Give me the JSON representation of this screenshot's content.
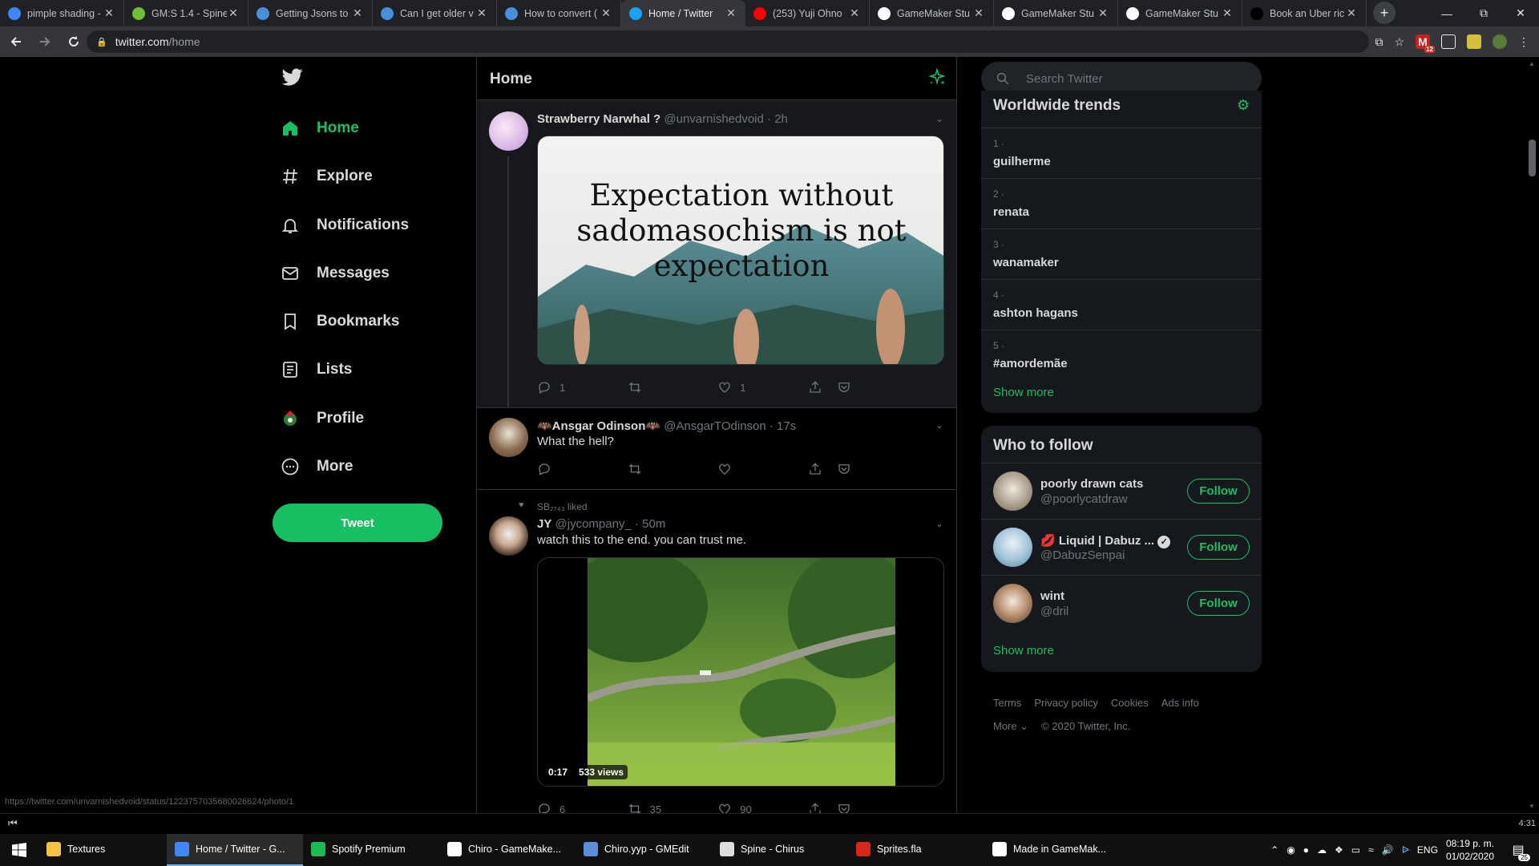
{
  "browser": {
    "tabs": [
      {
        "title": "pimple shading -",
        "icon": "google-icon",
        "color": "#4285f4",
        "active": false
      },
      {
        "title": "GM:S 1.4 - Spine",
        "icon": "gm-icon",
        "color": "#6fbf3a",
        "active": false
      },
      {
        "title": "Getting Jsons to",
        "icon": "forum-icon",
        "color": "#4a90d9",
        "active": false
      },
      {
        "title": "Can I get older v",
        "icon": "forum-icon",
        "color": "#4a90d9",
        "active": false
      },
      {
        "title": "How to convert (",
        "icon": "forum-icon",
        "color": "#4a90d9",
        "active": false
      },
      {
        "title": "Home / Twitter",
        "icon": "twitter-icon",
        "color": "#1da1f2",
        "active": true
      },
      {
        "title": "(253) Yuji Ohno",
        "icon": "youtube-icon",
        "color": "#ff0000",
        "active": false
      },
      {
        "title": "GameMaker Stu",
        "icon": "gamemaker-icon",
        "color": "#ffffff",
        "active": false
      },
      {
        "title": "GameMaker Stu",
        "icon": "gamemaker-icon",
        "color": "#ffffff",
        "active": false
      },
      {
        "title": "GameMaker Stu",
        "icon": "gamemaker-icon",
        "color": "#ffffff",
        "active": false
      },
      {
        "title": "Book an Uber ric",
        "icon": "uber-icon",
        "color": "#000000",
        "active": false
      }
    ],
    "url_host": "twitter.com",
    "url_path": "/home",
    "extension_badge": "12"
  },
  "twitter": {
    "nav": [
      {
        "label": "Home",
        "icon": "home-icon"
      },
      {
        "label": "Explore",
        "icon": "hashtag-icon"
      },
      {
        "label": "Notifications",
        "icon": "bell-icon"
      },
      {
        "label": "Messages",
        "icon": "envelope-icon"
      },
      {
        "label": "Bookmarks",
        "icon": "bookmark-icon"
      },
      {
        "label": "Lists",
        "icon": "list-icon"
      },
      {
        "label": "Profile",
        "icon": "profile-avatar-icon"
      },
      {
        "label": "More",
        "icon": "more-dots-icon"
      }
    ],
    "tweet_button": "Tweet",
    "feed_title": "Home",
    "tweets": [
      {
        "name": "Strawberry Narwhal ?",
        "handle": "@unvarnishedvoid",
        "time": "· 2h",
        "image_text": "Expectation without sadomasochism is not expectation",
        "replies": "1",
        "retweets": "",
        "likes": "1"
      },
      {
        "name": "🦇Ansgar Odinson🦇",
        "handle": "@AnsgarTOdinson",
        "time": "· 17s",
        "text": "What the hell?",
        "replies": "",
        "retweets": "",
        "likes": ""
      },
      {
        "liked_by": "SB₂₇₄₃ liked",
        "name": "JY",
        "handle": "@jycompany_",
        "time": "· 50m",
        "text": "watch this to the end. you can trust me.",
        "video_duration": "0:17",
        "video_views": "533 views",
        "replies": "6",
        "retweets": "35",
        "likes": "90"
      }
    ],
    "search_placeholder": "Search Twitter",
    "trends_title": "Worldwide trends",
    "trends": [
      {
        "rank": "1 ·",
        "name": "guilherme"
      },
      {
        "rank": "2 ·",
        "name": "renata"
      },
      {
        "rank": "3 ·",
        "name": "wanamaker"
      },
      {
        "rank": "4 ·",
        "name": "ashton hagans"
      },
      {
        "rank": "5 ·",
        "name": "#amordemãe"
      }
    ],
    "show_more": "Show more",
    "who_to_follow_title": "Who to follow",
    "follow_suggestions": [
      {
        "name": "poorly drawn cats",
        "handle": "@poorlycatdraw",
        "verified": false
      },
      {
        "name": "💋 Liquid | Dabuz ...",
        "handle": "@DabuzSenpai",
        "verified": true
      },
      {
        "name": "wint",
        "handle": "@dril",
        "verified": false
      }
    ],
    "follow_label": "Follow",
    "footer_links": [
      "Terms",
      "Privacy policy",
      "Cookies",
      "Ads info"
    ],
    "footer_more": "More ⌄",
    "copyright": "© 2020 Twitter, Inc.",
    "accent_color": "#17bf63"
  },
  "status_url": "https://twitter.com/unvarnishedvoid/status/1223757035680026624/photo/1",
  "media_bar_time": "4:31",
  "taskbar": {
    "apps": [
      {
        "label": "Textures",
        "icon": "folder-icon",
        "color": "#f5c242",
        "active": false
      },
      {
        "label": "Home / Twitter - G...",
        "icon": "chrome-icon",
        "color": "#4285f4",
        "active": true
      },
      {
        "label": "Spotify Premium",
        "icon": "spotify-icon",
        "color": "#1db954",
        "active": false
      },
      {
        "label": "Chiro - GameMake...",
        "icon": "gamemaker-icon",
        "color": "#ffffff",
        "active": false
      },
      {
        "label": "Chiro.yyp - GMEdit",
        "icon": "gmedit-icon",
        "color": "#5a8fd8",
        "active": false
      },
      {
        "label": "Spine - Chirus",
        "icon": "spine-icon",
        "color": "#dddddd",
        "active": false
      },
      {
        "label": "Sprites.fla",
        "icon": "animate-icon",
        "color": "#d9261c",
        "active": false
      },
      {
        "label": "Made in GameMak...",
        "icon": "gamemaker-icon",
        "color": "#ffffff",
        "active": false
      }
    ],
    "language": "ENG",
    "time": "08:19 p. m.",
    "date": "01/02/2020",
    "notifications": "25"
  }
}
